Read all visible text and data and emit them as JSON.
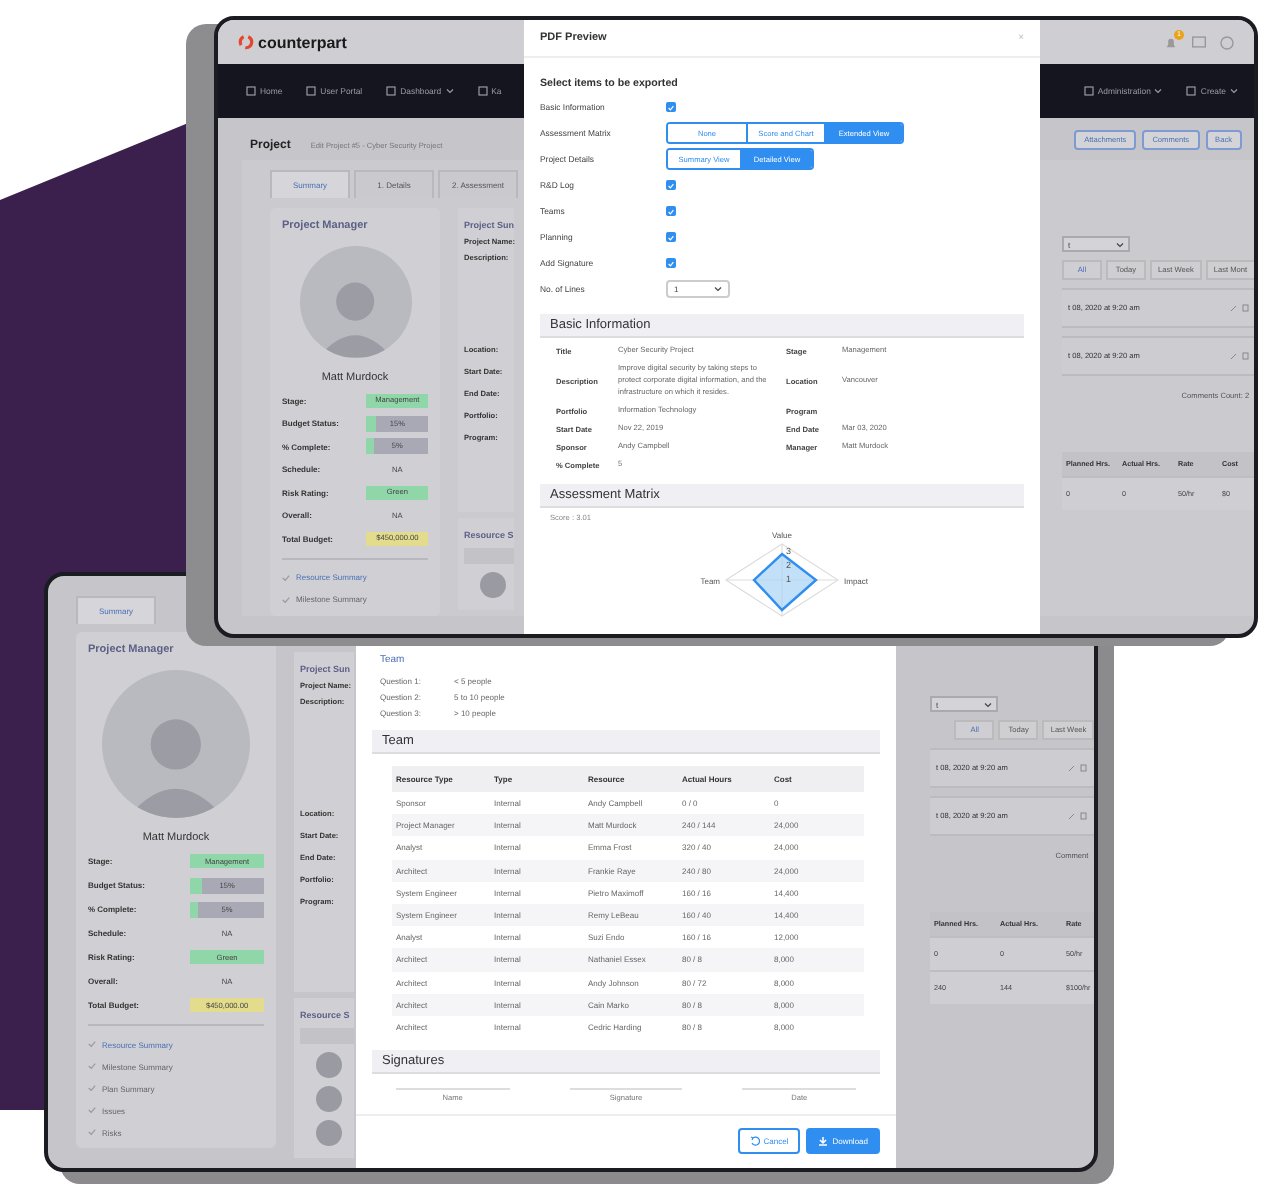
{
  "back_window": {
    "page": {
      "manager": {
        "title": "Project Manager",
        "name": "Matt Murdock",
        "rows": [
          {
            "label": "Stage:",
            "value": "Management",
            "kind": "pill",
            "color": "#8fd6a8"
          },
          {
            "label": "Budget Status:",
            "value": "15%",
            "kind": "bar",
            "level": 0.15
          },
          {
            "label": "% Complete:",
            "value": "5%",
            "kind": "bar",
            "level": 0.12
          },
          {
            "label": "Schedule:",
            "value": "NA",
            "kind": "text"
          },
          {
            "label": "Risk Rating:",
            "value": "Green",
            "kind": "pill",
            "color": "#8fd6a8"
          },
          {
            "label": "Overall:",
            "value": "NA",
            "kind": "text"
          },
          {
            "label": "Total Budget:",
            "value": "$450,000.00",
            "kind": "pill",
            "color": "#e2dc8c"
          }
        ],
        "links": [
          {
            "label": "Resource Summary",
            "selected": true
          },
          {
            "label": "Milestone Summary",
            "selected": false
          }
        ]
      },
      "summary": {
        "title": "Project Sun",
        "labels": [
          "Project Name:",
          "Description:"
        ],
        "labels_lower": [
          "Location:",
          "Start Date:",
          "End Date:",
          "Portfolio:",
          "Program:"
        ],
        "resources_title": "Resource S"
      },
      "activity": {
        "select": "t",
        "filters": [
          {
            "label": "All",
            "selected": true
          },
          {
            "label": "Today",
            "selected": false
          },
          {
            "label": "Last Week",
            "selected": false
          },
          {
            "label": "Last Mont",
            "selected": false
          }
        ],
        "entries": [
          "t 08, 2020 at 9:20 am",
          "t 08, 2020 at 9:20 am"
        ],
        "comments_count": "Comments Count: 2",
        "columns": [
          "Planned Hrs.",
          "Actual Hrs.",
          "Rate",
          "Cost"
        ],
        "rows": [
          [
            "0",
            "0",
            "50/hr",
            "$0"
          ]
        ]
      }
    },
    "brand": "counterpart",
    "notification_count": "1",
    "nav_left": [
      {
        "label": "Home",
        "dropdown": false
      },
      {
        "label": "User Portal",
        "dropdown": false
      },
      {
        "label": "Dashboard",
        "dropdown": true
      },
      {
        "label": "Ka",
        "dropdown": false
      }
    ],
    "nav_right": [
      {
        "label": "Administration",
        "dropdown": true
      },
      {
        "label": "Create",
        "dropdown": true
      }
    ],
    "header": {
      "title": "Project",
      "breadcrumb": "Edit Project #5 - Cyber Security Project",
      "actions": [
        "Attachments",
        "Comments",
        "Back"
      ]
    },
    "tabs": [
      {
        "label": "Summary",
        "selected": true
      },
      {
        "label": "1. Details",
        "selected": false
      },
      {
        "label": "2. Assessment",
        "selected": false
      }
    ],
    "modal": {
      "title": "PDF Preview",
      "close": "×",
      "heading": "Select items to be exported",
      "options": [
        {
          "label": "Basic Information",
          "kind": "checkbox",
          "checked": true
        },
        {
          "label": "Assessment Matrix",
          "kind": "segmented",
          "choices": [
            {
              "label": "None",
              "selected": false
            },
            {
              "label": "Score and Chart",
              "selected": false
            },
            {
              "label": "Extended View",
              "selected": true
            }
          ]
        },
        {
          "label": "Project Details",
          "kind": "segmented",
          "choices": [
            {
              "label": "Summary View",
              "selected": false
            },
            {
              "label": "Detailed View",
              "selected": true
            }
          ]
        },
        {
          "label": "R&D Log",
          "kind": "checkbox",
          "checked": true
        },
        {
          "label": "Teams",
          "kind": "checkbox",
          "checked": true
        },
        {
          "label": "Planning",
          "kind": "checkbox",
          "checked": true
        },
        {
          "label": "Add Signature",
          "kind": "checkbox",
          "checked": true
        },
        {
          "label": "No. of Lines",
          "kind": "select",
          "value": "1"
        }
      ],
      "basic_title": "Basic Information",
      "basic": [
        [
          "Title",
          "Cyber Security Project",
          "Stage",
          "Management"
        ],
        [
          "Description",
          "Improve digital security by taking steps to protect corporate digital information, and the infrastructure on which it resides.",
          "Location",
          "Vancouver"
        ],
        [
          "Portfolio",
          "Information Technology",
          "Program"
        ],
        [
          "Start Date",
          "Nov 22, 2019",
          "End Date",
          "Mar 03, 2020"
        ],
        [
          "Sponsor",
          "Andy Campbell",
          "Manager",
          "Matt Murdock"
        ],
        [
          "% Complete",
          "5"
        ]
      ],
      "matrix_title": "Assessment Matrix",
      "score": "Score : 3.01",
      "axes": [
        "Value",
        "Impact",
        "Team"
      ],
      "ticks": [
        "3",
        "2",
        "1"
      ]
    }
  },
  "front_window": {
    "page": {
      "tabs": [
        {
          "label": "Summary",
          "selected": true
        }
      ],
      "manager": {
        "title": "Project Manager",
        "name": "Matt Murdock",
        "rows": [
          {
            "label": "Stage:",
            "value": "Management",
            "kind": "pill",
            "color": "#8fd6a8"
          },
          {
            "label": "Budget Status:",
            "value": "15%",
            "kind": "bar",
            "level": 0.15
          },
          {
            "label": "% Complete:",
            "value": "5%",
            "kind": "bar",
            "level": 0.12
          },
          {
            "label": "Schedule:",
            "value": "NA",
            "kind": "text"
          },
          {
            "label": "Risk Rating:",
            "value": "Green",
            "kind": "pill",
            "color": "#8fd6a8"
          },
          {
            "label": "Overall:",
            "value": "NA",
            "kind": "text"
          },
          {
            "label": "Total Budget:",
            "value": "$450,000.00",
            "kind": "pill",
            "color": "#e2dc8c"
          }
        ],
        "links": [
          {
            "label": "Resource Summary",
            "selected": true
          },
          {
            "label": "Milestone Summary",
            "selected": false
          },
          {
            "label": "Plan Summary",
            "selected": false
          },
          {
            "label": "Issues",
            "selected": false
          },
          {
            "label": "Risks",
            "selected": false
          }
        ]
      },
      "summary": {
        "title": "Project Sun",
        "labels": [
          "Project Name:",
          "Description:"
        ],
        "labels_lower": [
          "Location:",
          "Start Date:",
          "End Date:",
          "Portfolio:",
          "Program:"
        ],
        "resources_title": "Resource S"
      },
      "activity": {
        "select": "t",
        "filters": [
          {
            "label": "All",
            "selected": true
          },
          {
            "label": "Today",
            "selected": false
          },
          {
            "label": "Last Week",
            "selected": false
          }
        ],
        "entries": [
          "t 08, 2020 at 9:20 am",
          "t 08, 2020 at 9:20 am"
        ],
        "comments_count": "Comment",
        "columns": [
          "Planned Hrs.",
          "Actual Hrs.",
          "Rate"
        ],
        "rows": [
          [
            "0",
            "0",
            "50/hr"
          ],
          [
            "240",
            "144",
            "$100/hr"
          ]
        ]
      }
    },
    "modal": {
      "team_link": "Team",
      "questions": [
        {
          "label": "Question 1:",
          "value": "< 5 people"
        },
        {
          "label": "Question 2:",
          "value": "5 to 10 people"
        },
        {
          "label": "Question 3:",
          "value": "> 10 people"
        }
      ],
      "team_title": "Team",
      "columns": [
        "Resource Type",
        "Type",
        "Resource",
        "Actual Hours",
        "Cost"
      ],
      "rows": [
        [
          "Sponsor",
          "Internal",
          "Andy Campbell",
          "0 / 0",
          "0"
        ],
        [
          "Project Manager",
          "Internal",
          "Matt Murdock",
          "240 / 144",
          "24,000"
        ],
        [
          "Analyst",
          "Internal",
          "Emma Frost",
          "320 / 40",
          "24,000"
        ],
        [
          "Architect",
          "Internal",
          "Frankie Raye",
          "240 / 80",
          "24,000"
        ],
        [
          "System Engineer",
          "Internal",
          "Pietro Maximoff",
          "160 / 16",
          "14,400"
        ],
        [
          "System Engineer",
          "Internal",
          "Remy LeBeau",
          "160 / 40",
          "14,400"
        ],
        [
          "Analyst",
          "Internal",
          "Suzi Endo",
          "160 / 16",
          "12,000"
        ],
        [
          "Architect",
          "Internal",
          "Nathaniel Essex",
          "80 / 8",
          "8,000"
        ],
        [
          "Architect",
          "Internal",
          "Andy Johnson",
          "80 / 72",
          "8,000"
        ],
        [
          "Architect",
          "Internal",
          "Cain Marko",
          "80 / 8",
          "8,000"
        ],
        [
          "Architect",
          "Internal",
          "Cedric Harding",
          "80 / 8",
          "8,000"
        ]
      ],
      "signatures_title": "Signatures",
      "signature_fields": [
        "Name",
        "Signature",
        "Date"
      ],
      "buttons": [
        {
          "label": "Cancel",
          "kind": "secondary"
        },
        {
          "label": "Download",
          "kind": "primary"
        }
      ]
    }
  }
}
